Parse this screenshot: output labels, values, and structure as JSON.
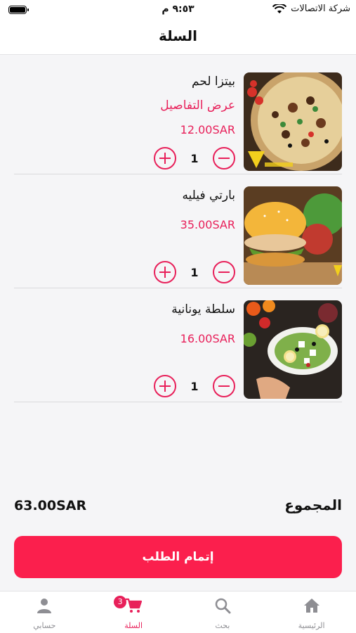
{
  "status_bar": {
    "carrier": "شركة الاتصالات",
    "time": "٩:٥٣ م"
  },
  "header": {
    "title": "السلة"
  },
  "cart": {
    "items": [
      {
        "name": "بيتزا لحم",
        "details_link": "عرض التفاصيل",
        "price": "12.00SAR",
        "quantity": "1",
        "image": "pizza"
      },
      {
        "name": "بارتي فيليه",
        "price": "35.00SAR",
        "quantity": "1",
        "image": "burger"
      },
      {
        "name": "سلطة يونانية",
        "price": "16.00SAR",
        "quantity": "1",
        "image": "salad"
      }
    ]
  },
  "total": {
    "label": "المجموع",
    "value": "63.00SAR"
  },
  "checkout": {
    "label": "إتمام الطلب"
  },
  "tabs": [
    {
      "label": "الرئيسية",
      "icon": "home-icon"
    },
    {
      "label": "بحث",
      "icon": "search-icon"
    },
    {
      "label": "السلة",
      "icon": "cart-icon",
      "badge": "3",
      "active": true
    },
    {
      "label": "حسابي",
      "icon": "user-icon"
    }
  ],
  "colors": {
    "accent": "#e8205a",
    "button": "#fb1f4d"
  }
}
